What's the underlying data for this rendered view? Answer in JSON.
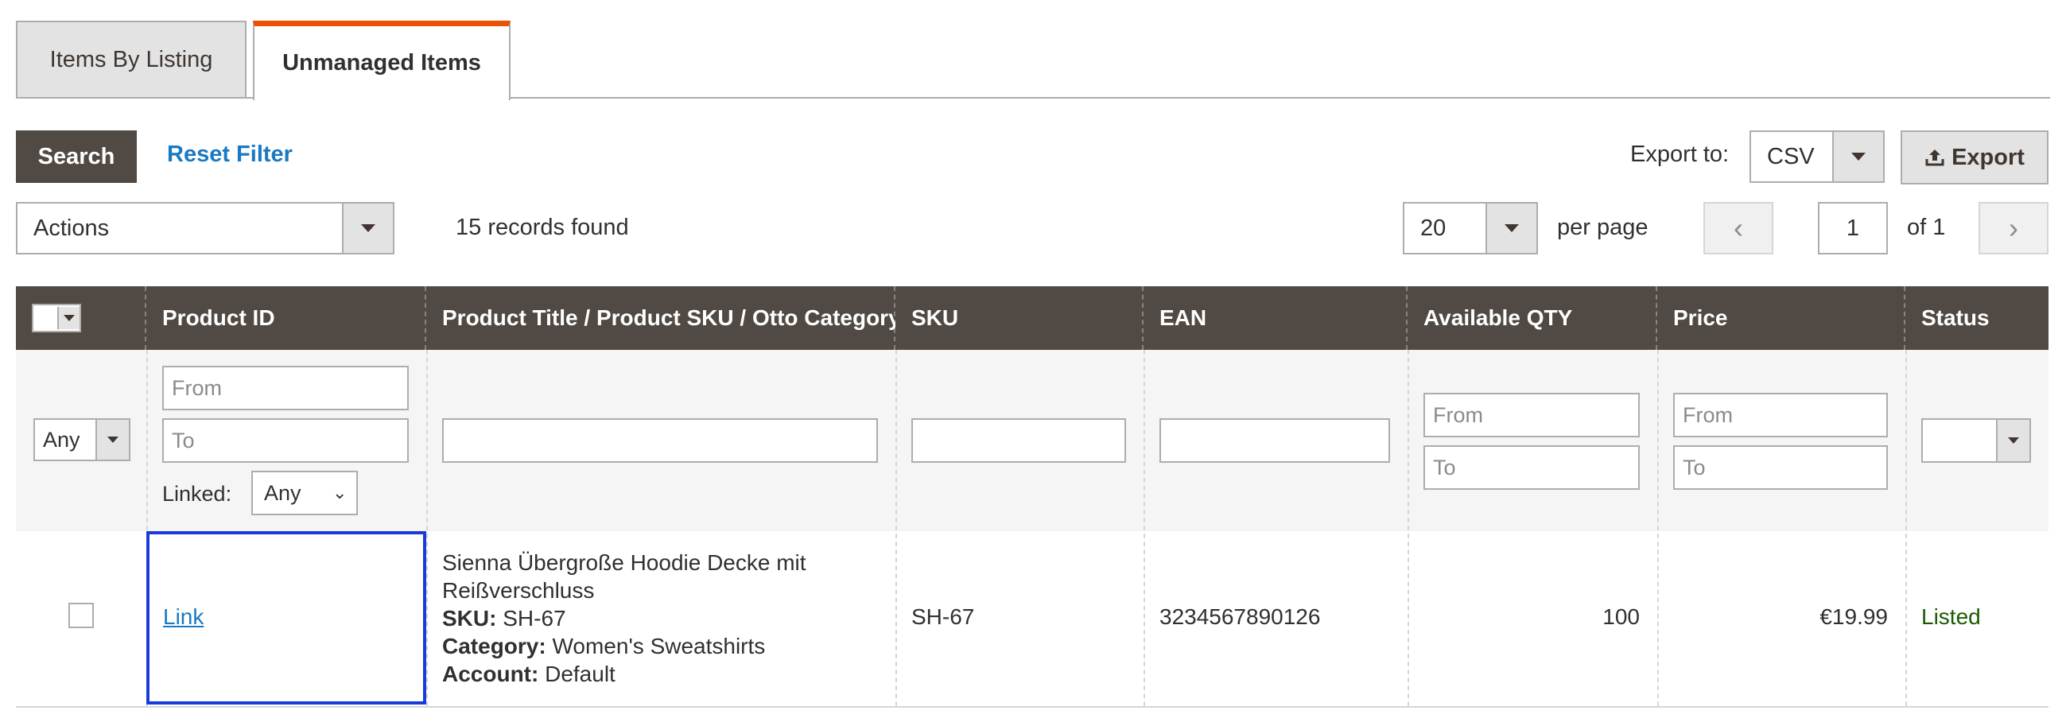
{
  "tabs": [
    {
      "label": "Items By Listing",
      "active": false
    },
    {
      "label": "Unmanaged Items",
      "active": true
    }
  ],
  "toolbar": {
    "search_label": "Search",
    "reset_filter_label": "Reset Filter",
    "export_to_label": "Export to:",
    "export_format": "CSV",
    "export_label": "Export",
    "actions_value": "Actions",
    "records_found": "15 records found",
    "per_page_value": "20",
    "per_page_label": "per page",
    "page_current": "1",
    "page_total": "of 1"
  },
  "table": {
    "columns": [
      "Product ID",
      "Product Title / Product SKU / Otto Category",
      "SKU",
      "EAN",
      "Available QTY",
      "Price",
      "Status"
    ],
    "filters": {
      "select_value": "Any",
      "product_id_from_placeholder": "From",
      "product_id_to_placeholder": "To",
      "linked_label": "Linked:",
      "linked_value": "Any",
      "qty_from_placeholder": "From",
      "qty_to_placeholder": "To",
      "price_from_placeholder": "From",
      "price_to_placeholder": "To",
      "status_value": ""
    },
    "rows": [
      {
        "product_id_link": "Link",
        "title_line1": "Sienna Übergroße Hoodie Decke mit",
        "title_line2": "Reißverschluss",
        "sku_label": "SKU:",
        "sku_value": "SH-67",
        "category_label": "Category:",
        "category_value": "Women's Sweatshirts",
        "account_label": "Account:",
        "account_value": "Default",
        "sku": "SH-67",
        "ean": "3234567890126",
        "available_qty": "100",
        "price": "€19.99",
        "status": "Listed"
      }
    ]
  },
  "colors": {
    "header_bg": "#514943",
    "accent_tab": "#eb5202",
    "link": "#1979c3",
    "status_listed": "#185b00",
    "selection": "#1a3bdb"
  }
}
